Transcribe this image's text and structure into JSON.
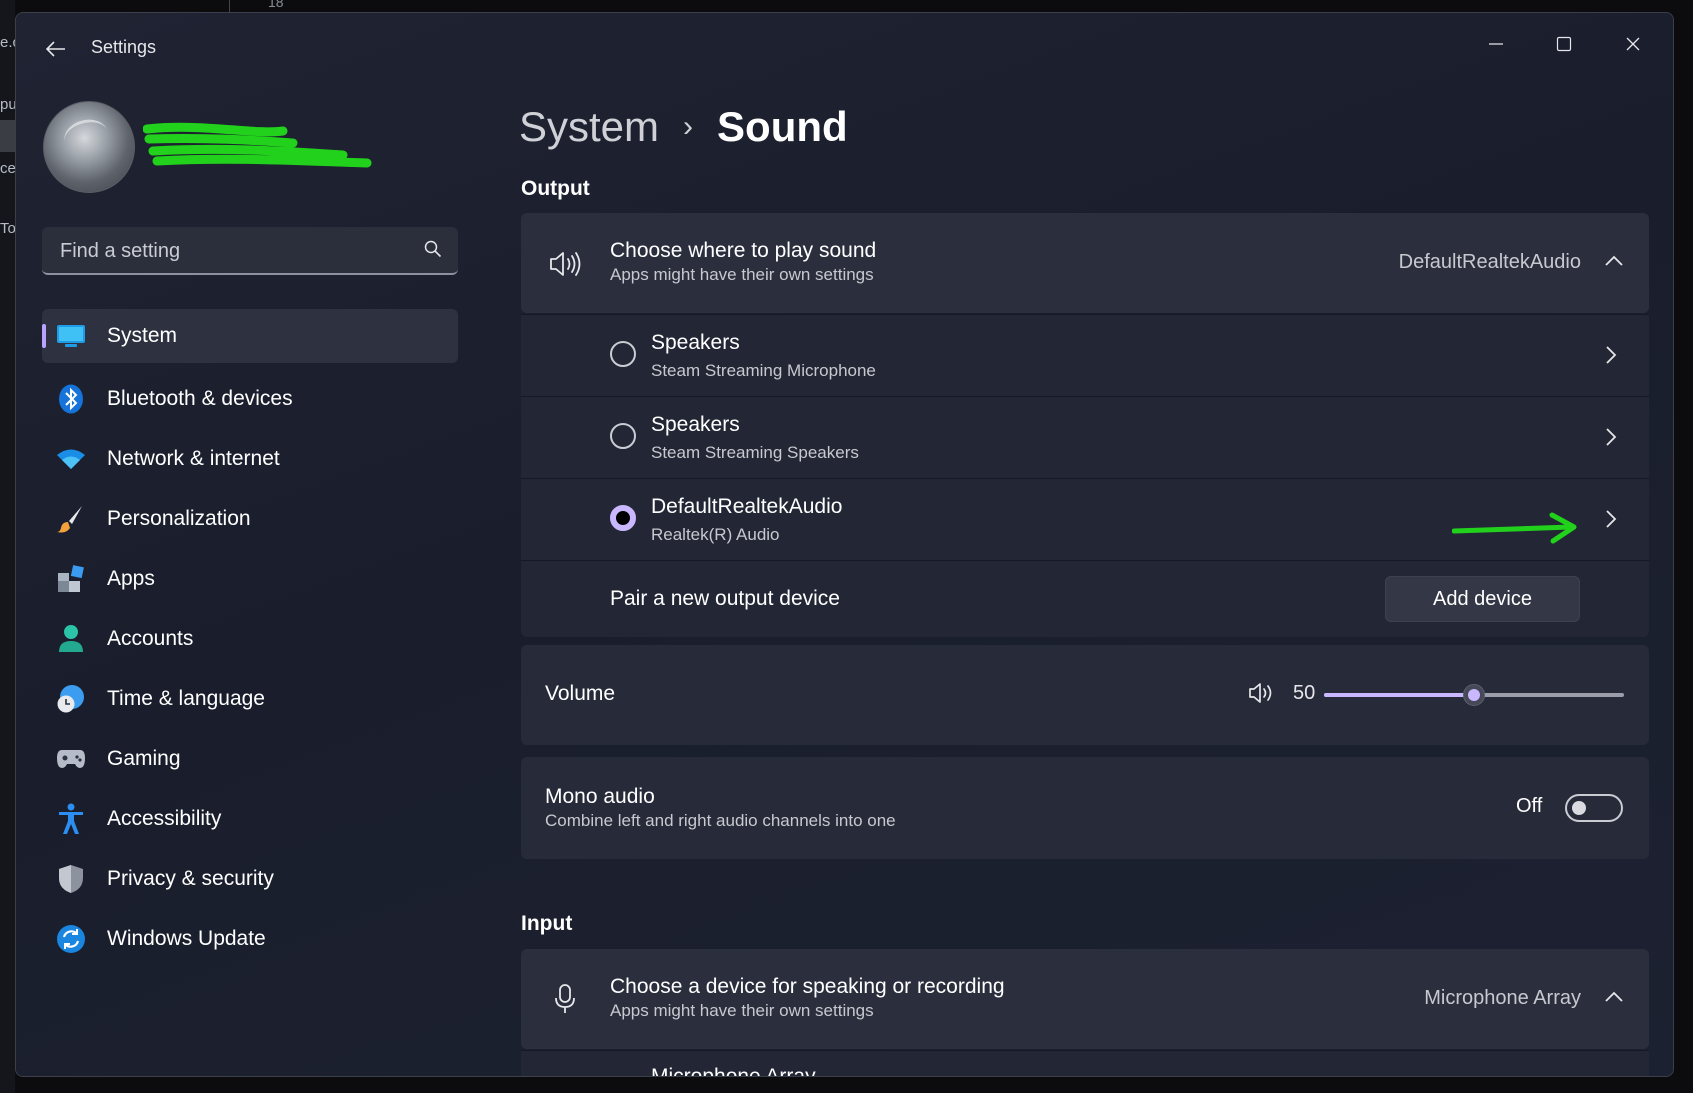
{
  "window": {
    "title": "Settings"
  },
  "desktop": {
    "top_number": "18",
    "left_fragments": [
      "e.c",
      "pu",
      "ce",
      "To"
    ]
  },
  "sidebar": {
    "search_placeholder": "Find a setting",
    "items": [
      {
        "label": "System",
        "icon": "monitor-icon",
        "active": true
      },
      {
        "label": "Bluetooth & devices",
        "icon": "bluetooth-icon"
      },
      {
        "label": "Network & internet",
        "icon": "wifi-icon"
      },
      {
        "label": "Personalization",
        "icon": "paintbrush-icon"
      },
      {
        "label": "Apps",
        "icon": "apps-icon"
      },
      {
        "label": "Accounts",
        "icon": "person-icon"
      },
      {
        "label": "Time & language",
        "icon": "globe-clock-icon"
      },
      {
        "label": "Gaming",
        "icon": "gamepad-icon"
      },
      {
        "label": "Accessibility",
        "icon": "accessibility-icon"
      },
      {
        "label": "Privacy & security",
        "icon": "shield-icon"
      },
      {
        "label": "Windows Update",
        "icon": "update-icon"
      }
    ]
  },
  "breadcrumb": {
    "parent": "System",
    "separator": "›",
    "current": "Sound"
  },
  "output": {
    "heading": "Output",
    "choose": {
      "title": "Choose where to play sound",
      "subtitle": "Apps might have their own settings",
      "value": "DefaultRealtekAudio"
    },
    "devices": [
      {
        "name": "Speakers",
        "detail": "Steam Streaming Microphone",
        "selected": false
      },
      {
        "name": "Speakers",
        "detail": "Steam Streaming Speakers",
        "selected": false
      },
      {
        "name": "DefaultRealtekAudio",
        "detail": "Realtek(R) Audio",
        "selected": true
      }
    ],
    "pair": {
      "label": "Pair a new output device",
      "button": "Add device"
    },
    "volume": {
      "label": "Volume",
      "value": "50",
      "level": 0.5
    },
    "mono": {
      "title": "Mono audio",
      "subtitle": "Combine left and right audio channels into one",
      "state": "Off"
    }
  },
  "input": {
    "heading": "Input",
    "choose": {
      "title": "Choose a device for speaking or recording",
      "subtitle": "Apps might have their own settings",
      "value": "Microphone Array"
    },
    "partial_row": "Microphone Array"
  },
  "colors": {
    "accent": "#c9b8ff",
    "annotation": "#22d11c"
  }
}
